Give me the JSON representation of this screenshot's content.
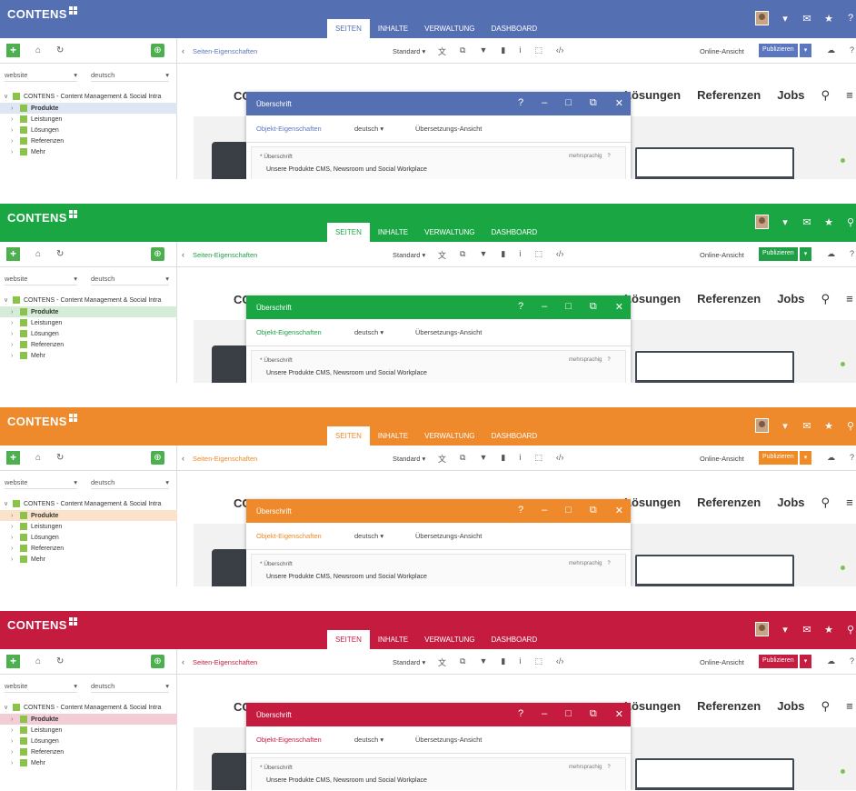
{
  "app": {
    "logo_text": "CONTENS"
  },
  "top_tabs": [
    "SEITEN",
    "INHALTE",
    "VERWALTUNG",
    "DASHBOARD"
  ],
  "toolbar": {
    "props_link": "Seiten-Eigenschaften",
    "standard_label": "Standard",
    "online_view": "Online-Ansicht",
    "publish_label": "Publizieren"
  },
  "sidebar": {
    "site_select": "website",
    "lang_select": "deutsch",
    "root_item": "CONTENS - Content Management & Social Intra",
    "items": [
      "Produkte",
      "Leistungen",
      "Lösungen",
      "Referenzen",
      "Mehr"
    ]
  },
  "website": {
    "logo_partial": "CC",
    "nav_items": [
      "Lösungen",
      "Referenzen",
      "Jobs"
    ]
  },
  "dialog": {
    "title": "Überschrift",
    "tab_object_props": "Objekt-Eigenschaften",
    "tab_language": "deutsch",
    "tab_translation": "Übersetzungs-Ansicht",
    "field_label": "Überschrift",
    "field_multilang": "mehrsprachig",
    "field_help": "?",
    "field_value": "Unsere Produkte CMS, Newsroom und Social Workplace"
  },
  "variants": [
    {
      "name": "blue",
      "primary": "#5470b3",
      "accent": "#5a77bf",
      "highlight": "#dfe6f3",
      "top_icons": [
        "chevron-down-icon",
        "message-add-icon",
        "star-icon",
        "help-icon"
      ]
    },
    {
      "name": "green",
      "primary": "#1aa643",
      "accent": "#1fa046",
      "highlight": "#d4ecd8",
      "top_icons": [
        "chevron-down-icon",
        "message-add-icon",
        "star-icon",
        "search-icon"
      ]
    },
    {
      "name": "orange",
      "primary": "#ee8a2b",
      "accent": "#ef8a25",
      "highlight": "#fbe3cb",
      "top_icons": [
        "chevron-down-icon",
        "message-add-icon",
        "star-icon",
        "search-icon"
      ]
    },
    {
      "name": "red",
      "primary": "#c41b3e",
      "accent": "#c51c40",
      "highlight": "#f3cdd5",
      "top_icons": [
        "chevron-down-icon",
        "message-add-icon",
        "star-icon",
        "search-icon"
      ]
    }
  ]
}
